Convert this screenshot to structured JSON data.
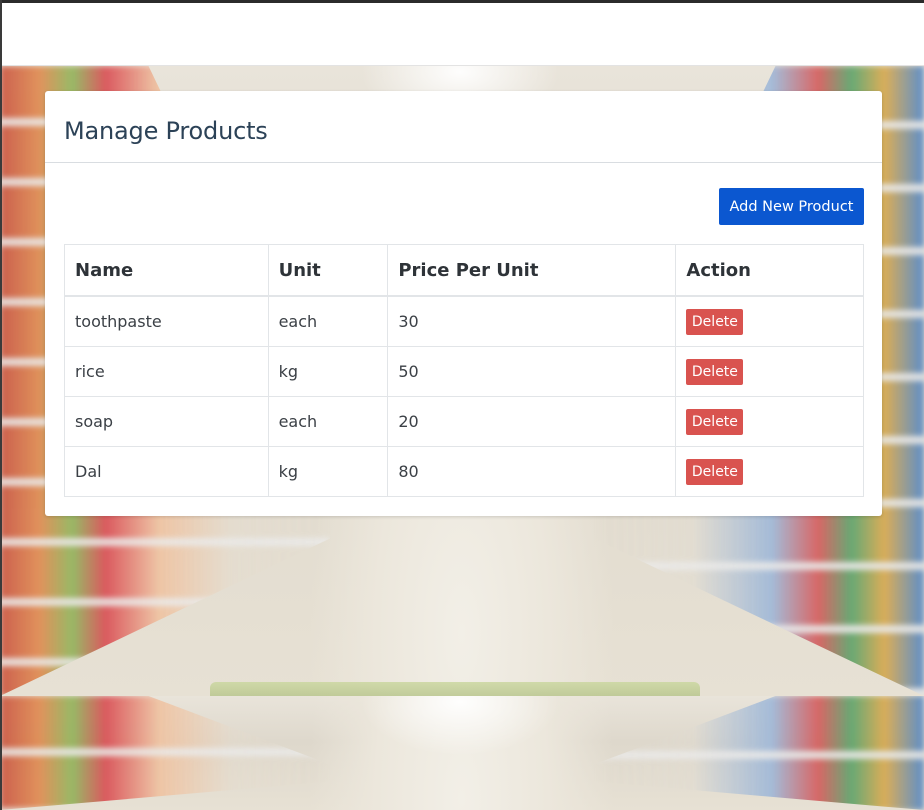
{
  "page": {
    "title": "Manage Products",
    "add_button_label": "Add New Product"
  },
  "table": {
    "headers": [
      "Name",
      "Unit",
      "Price Per Unit",
      "Action"
    ],
    "rows": [
      {
        "name": "toothpaste",
        "unit": "each",
        "price": "30",
        "action": "Delete"
      },
      {
        "name": "rice",
        "unit": "kg",
        "price": "50",
        "action": "Delete"
      },
      {
        "name": "soap",
        "unit": "each",
        "price": "20",
        "action": "Delete"
      },
      {
        "name": "Dal",
        "unit": "kg",
        "price": "80",
        "action": "Delete"
      }
    ]
  },
  "colors": {
    "primary_button": "#0b57d0",
    "danger_button": "#d9534f",
    "title_text": "#2c4257"
  },
  "background": {
    "image": "blurred-supermarket-aisle"
  }
}
